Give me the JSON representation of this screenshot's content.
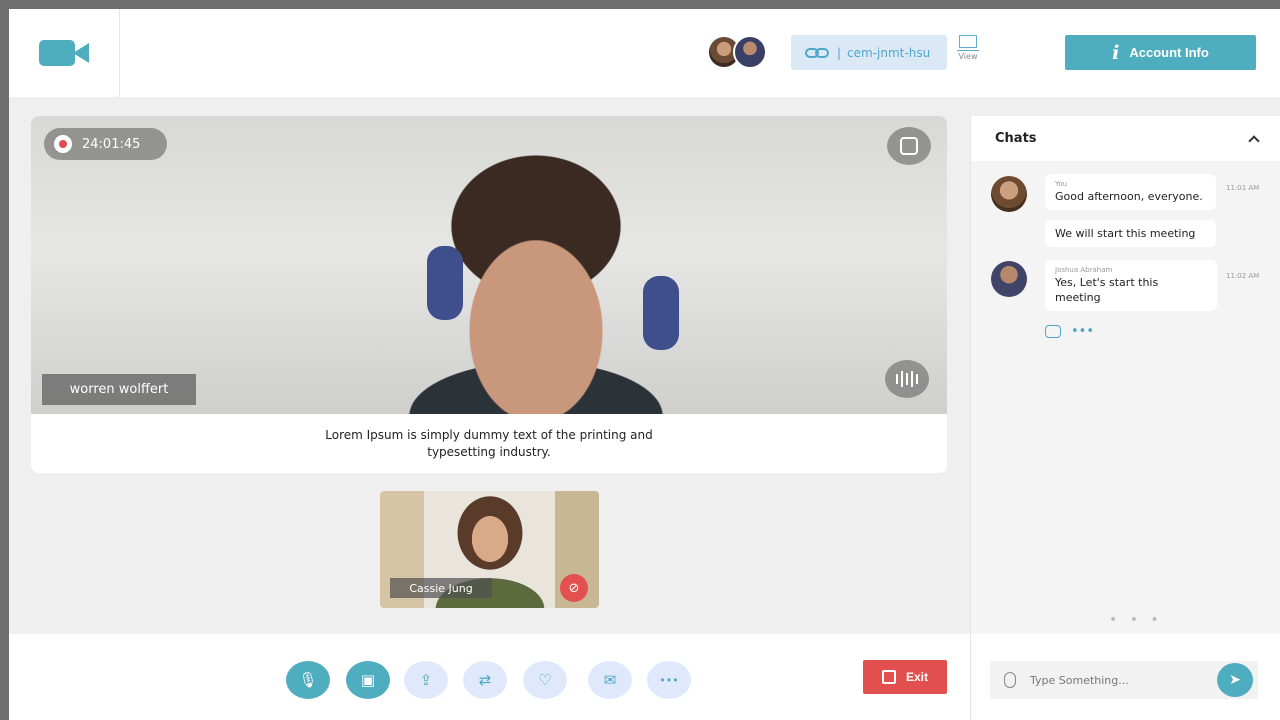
{
  "header": {
    "meeting_code": "cem-jnmt-hsu",
    "view_label": "View",
    "account_label": "Account Info",
    "brand_color": "#4fadc0"
  },
  "main_video": {
    "timer": "24:01:45",
    "speaker_name": "worren wolffert",
    "caption": "Lorem Ipsum is simply dummy text of the printing and typesetting industry."
  },
  "thumbnail": {
    "name": "Cassie Jung",
    "muted_icon": "mic-off-icon"
  },
  "chat": {
    "title": "Chats",
    "messages": [
      {
        "sender": "You",
        "texts": [
          "Good afternoon, everyone.",
          "We will start this meeting"
        ],
        "time": "11:01 AM"
      },
      {
        "sender": "Joshua Abraham",
        "texts": [
          "Yes, Let's start this meeting"
        ],
        "time": "11:02 AM"
      }
    ],
    "typing_indicator": "• • •",
    "input_placeholder": "Type Something..."
  },
  "controls": {
    "items": [
      {
        "name": "microphone",
        "icon": "🎙"
      },
      {
        "name": "camera",
        "icon": "▣"
      },
      {
        "name": "share-screen",
        "icon": "⇪"
      },
      {
        "name": "participants",
        "icon": "⇄"
      },
      {
        "name": "reactions",
        "icon": "♡"
      },
      {
        "name": "chat",
        "icon": "✉"
      },
      {
        "name": "more",
        "icon": "•••"
      }
    ],
    "exit_label": "Exit",
    "exit_color": "#e14f4f"
  }
}
